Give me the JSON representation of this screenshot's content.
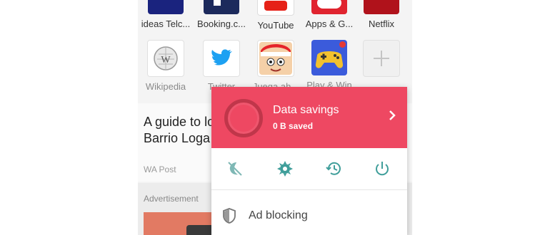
{
  "speed_dial": {
    "row1": [
      {
        "label": "ideas Telc...",
        "icon": "telco-icon",
        "color": "#1a237e"
      },
      {
        "label": "Booking.c...",
        "icon": "booking-icon",
        "color": "#1c2a5c"
      },
      {
        "label": "YouTube",
        "icon": "youtube-icon",
        "color": "#e62117"
      },
      {
        "label": "Apps & G...",
        "icon": "apps-games-icon",
        "color": "#e0242f"
      },
      {
        "label": "Netflix",
        "icon": "netflix-icon",
        "color": "#b0121b"
      }
    ],
    "row2": [
      {
        "label": "Wikipedia",
        "icon": "wikipedia-icon"
      },
      {
        "label": "Twitter",
        "icon": "twitter-icon"
      },
      {
        "label": "Juega ah...",
        "icon": "game-character-icon"
      },
      {
        "label": "Play & Win",
        "icon": "gamepad-icon"
      },
      {
        "label": "",
        "icon": "add-icon"
      }
    ]
  },
  "feed": {
    "headline": "A guide to lo",
    "headline_line2": "Barrio Loga",
    "source": "WA Post",
    "advertisement_label": "Advertisement"
  },
  "menu": {
    "data_savings_title": "Data savings",
    "data_savings_value": "0 B saved",
    "savings_color": "#ee4862",
    "icon_color": "#3f9e9a",
    "icons": [
      "night-mode-off-icon",
      "settings-icon",
      "history-icon",
      "power-icon"
    ],
    "ad_blocking_label": "Ad blocking"
  }
}
